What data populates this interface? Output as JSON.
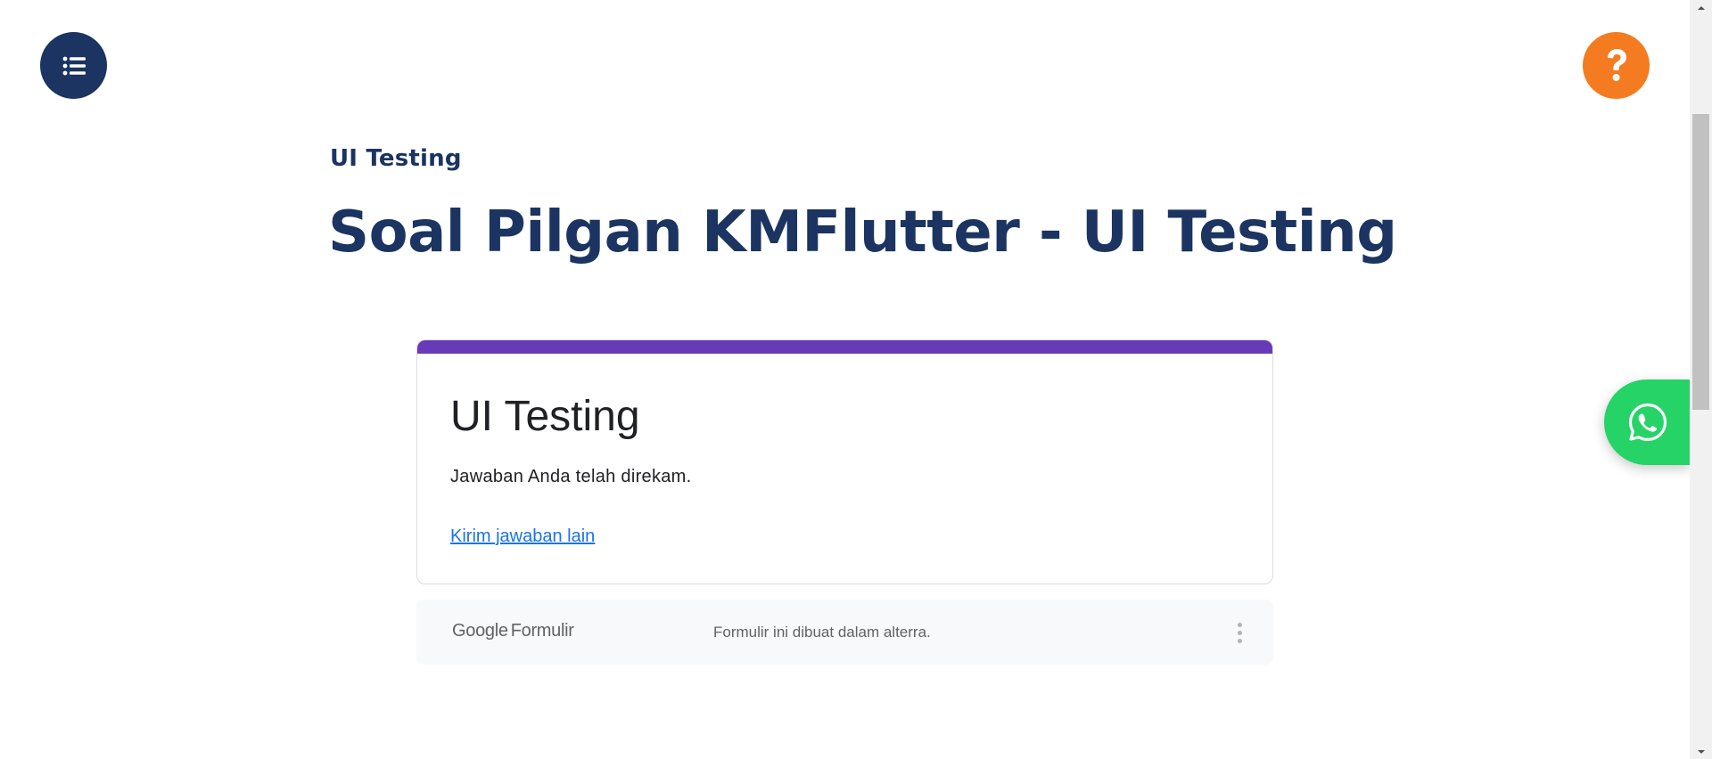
{
  "header": {
    "menu_icon": "list-icon",
    "help_icon": "question-mark-icon",
    "category": "UI Testing",
    "title": "Soal Pilgan KMFlutter - UI Testing"
  },
  "form": {
    "title": "UI Testing",
    "message": "Jawaban Anda telah direkam.",
    "resubmit_link": "Kirim jawaban lain",
    "accent_color": "#673ab7"
  },
  "footer": {
    "logo_brand": "Google",
    "logo_product": "Formulir",
    "note": "Formulir ini dibuat dalam alterra.",
    "more_icon": "more-vertical-icon"
  },
  "floating": {
    "whatsapp_icon": "whatsapp-icon"
  },
  "colors": {
    "navy": "#1b3461",
    "orange": "#f47b20",
    "green": "#25d366",
    "link": "#1a73e8"
  }
}
